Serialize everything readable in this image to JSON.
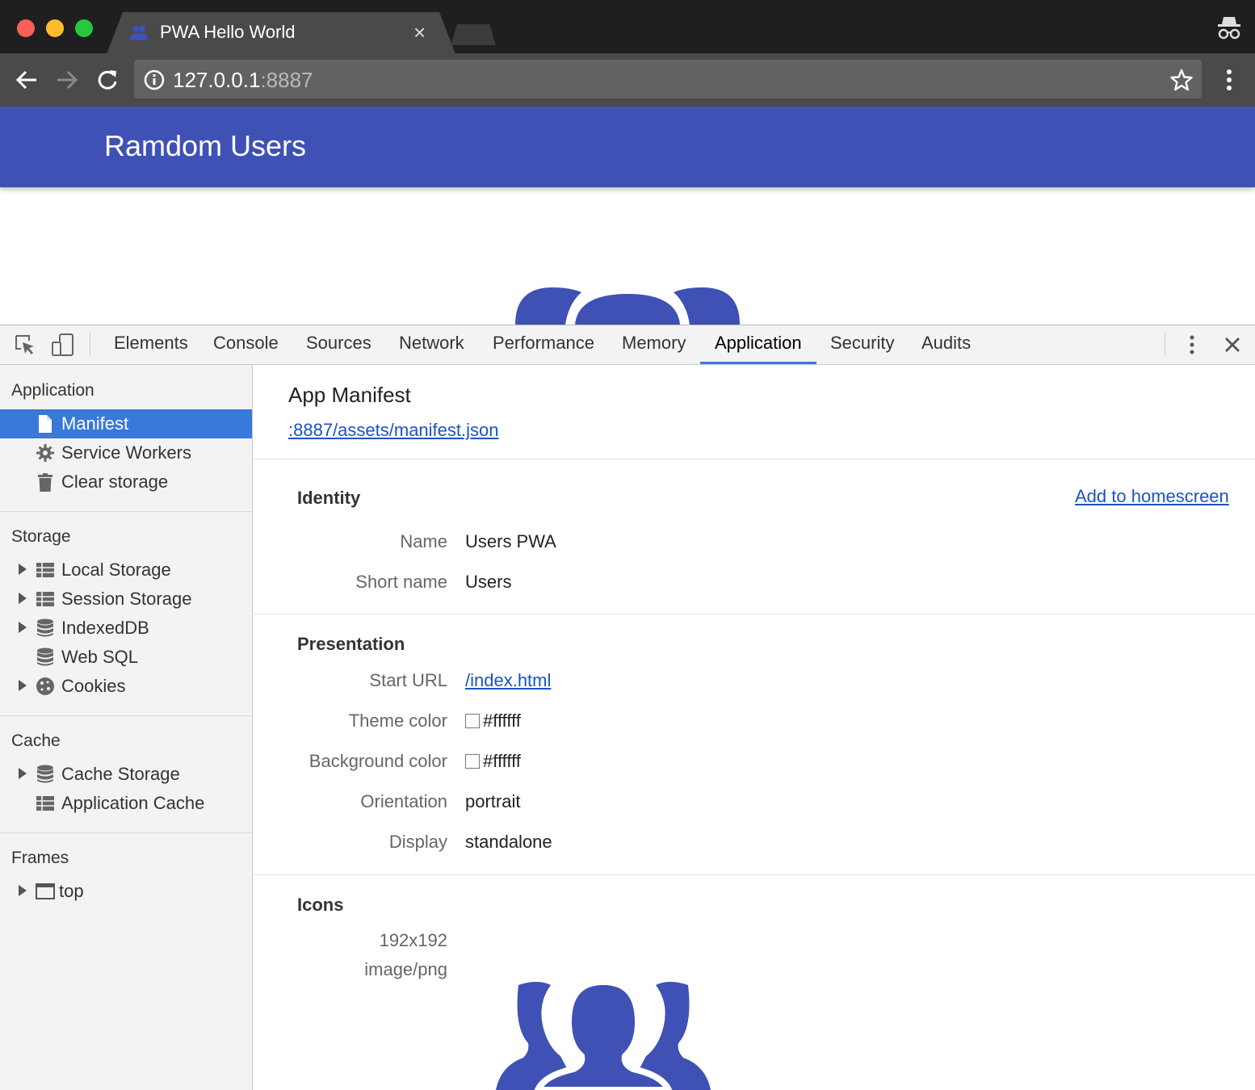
{
  "browser": {
    "tab_title": "PWA Hello World",
    "tab_close": "×",
    "url_host": "127.0.0.1",
    "url_port": ":8887"
  },
  "page": {
    "app_title": "Ramdom Users"
  },
  "devtools": {
    "tabs": [
      "Elements",
      "Console",
      "Sources",
      "Network",
      "Performance",
      "Memory",
      "Application",
      "Security",
      "Audits"
    ],
    "active_tab": "Application",
    "sidebar": {
      "application_header": "Application",
      "application_items": [
        "Manifest",
        "Service Workers",
        "Clear storage"
      ],
      "storage_header": "Storage",
      "storage_items": [
        "Local Storage",
        "Session Storage",
        "IndexedDB",
        "Web SQL",
        "Cookies"
      ],
      "cache_header": "Cache",
      "cache_items": [
        "Cache Storage",
        "Application Cache"
      ],
      "frames_header": "Frames",
      "frames_items": [
        "top"
      ]
    },
    "manifest": {
      "title": "App Manifest",
      "link": ":8887/assets/manifest.json",
      "identity": {
        "header": "Identity",
        "add_to_homescreen": "Add to homescreen",
        "name_label": "Name",
        "name_value": "Users PWA",
        "short_name_label": "Short name",
        "short_name_value": "Users"
      },
      "presentation": {
        "header": "Presentation",
        "start_url_label": "Start URL",
        "start_url_value": "/index.html",
        "theme_color_label": "Theme color",
        "theme_color_value": "#ffffff",
        "background_color_label": "Background color",
        "background_color_value": "#ffffff",
        "orientation_label": "Orientation",
        "orientation_value": "portrait",
        "display_label": "Display",
        "display_value": "standalone"
      },
      "icons": {
        "header": "Icons",
        "size": "192x192",
        "type": "image/png"
      }
    }
  },
  "colors": {
    "app_primary": "#3f51b5",
    "selection": "#3879d9",
    "link": "#1a53c6"
  }
}
